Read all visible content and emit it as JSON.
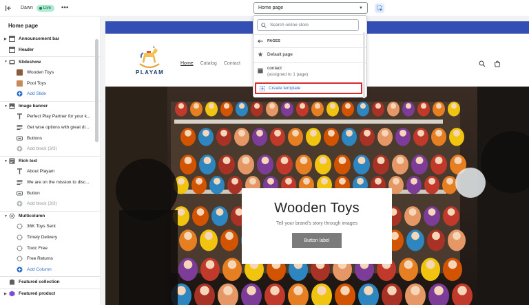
{
  "topbar": {
    "theme_name": "Dawn",
    "status_badge": "Live",
    "more_label": "•••",
    "page_selector": "Home page"
  },
  "sidebar": {
    "title": "Home page",
    "sections": [
      {
        "label": "Announcement bar",
        "icon": "layout-icon",
        "expandable": true,
        "blocks": []
      },
      {
        "label": "Header",
        "icon": "layout-icon",
        "expandable": false,
        "blocks": []
      },
      {
        "label": "Slideshow",
        "icon": "slideshow-icon",
        "expandable": true,
        "blocks": [
          {
            "label": "Wooden Toys",
            "icon": "image-thumb"
          },
          {
            "label": "Pool Toys",
            "icon": "image-thumb"
          },
          {
            "label": "Add Slide",
            "icon": "plus-circle-icon",
            "kind": "add"
          }
        ]
      },
      {
        "label": "Image banner",
        "icon": "image-banner-icon",
        "expandable": true,
        "blocks": [
          {
            "label": "Perfect Play Partner for your k...",
            "icon": "text-icon"
          },
          {
            "label": "Get wise options with great di...",
            "icon": "paragraph-icon"
          },
          {
            "label": "Buttons",
            "icon": "button-icon"
          },
          {
            "label": "Add block (3/3)",
            "icon": "plus-circle-icon",
            "kind": "disabled"
          }
        ]
      },
      {
        "label": "Rich text",
        "icon": "rich-text-icon",
        "expandable": true,
        "blocks": [
          {
            "label": "About Playam",
            "icon": "text-icon"
          },
          {
            "label": "We are on the mission to disc...",
            "icon": "paragraph-icon"
          },
          {
            "label": "Button",
            "icon": "button-icon"
          },
          {
            "label": "Add block (3/3)",
            "icon": "plus-circle-icon",
            "kind": "disabled"
          }
        ]
      },
      {
        "label": "Multicolumn",
        "icon": "gear-icon",
        "expandable": true,
        "blocks": [
          {
            "label": "36K Toys Sent",
            "icon": "column-icon"
          },
          {
            "label": "Timely Delivery",
            "icon": "column-icon"
          },
          {
            "label": "Toxic Free",
            "icon": "column-icon"
          },
          {
            "label": "Free Returns",
            "icon": "column-icon"
          },
          {
            "label": "Add Column",
            "icon": "plus-circle-icon",
            "kind": "add"
          }
        ]
      },
      {
        "label": "Featured collection",
        "icon": "collection-icon",
        "expandable": false,
        "blocks": []
      },
      {
        "label": "Featured product",
        "icon": "product-icon",
        "expandable": true,
        "blocks": []
      }
    ]
  },
  "dropdown": {
    "search_placeholder": "Search online store",
    "group_label": "PAGES",
    "items": [
      {
        "label": "Default page",
        "sub": ""
      },
      {
        "label": "contact",
        "sub": "(assigned to 1 page)"
      }
    ],
    "create_label": "Create template"
  },
  "store": {
    "logo_text": "PLAYAM",
    "nav": [
      "Home",
      "Catalog",
      "Contact"
    ],
    "hero_title": "Wooden Toys",
    "hero_subtitle": "Tell your brand's story through images",
    "hero_button": "Button label"
  },
  "colors": {
    "accent": "#2c6ecb",
    "announcement": "#334fb4",
    "highlight": "#d82c2c"
  }
}
